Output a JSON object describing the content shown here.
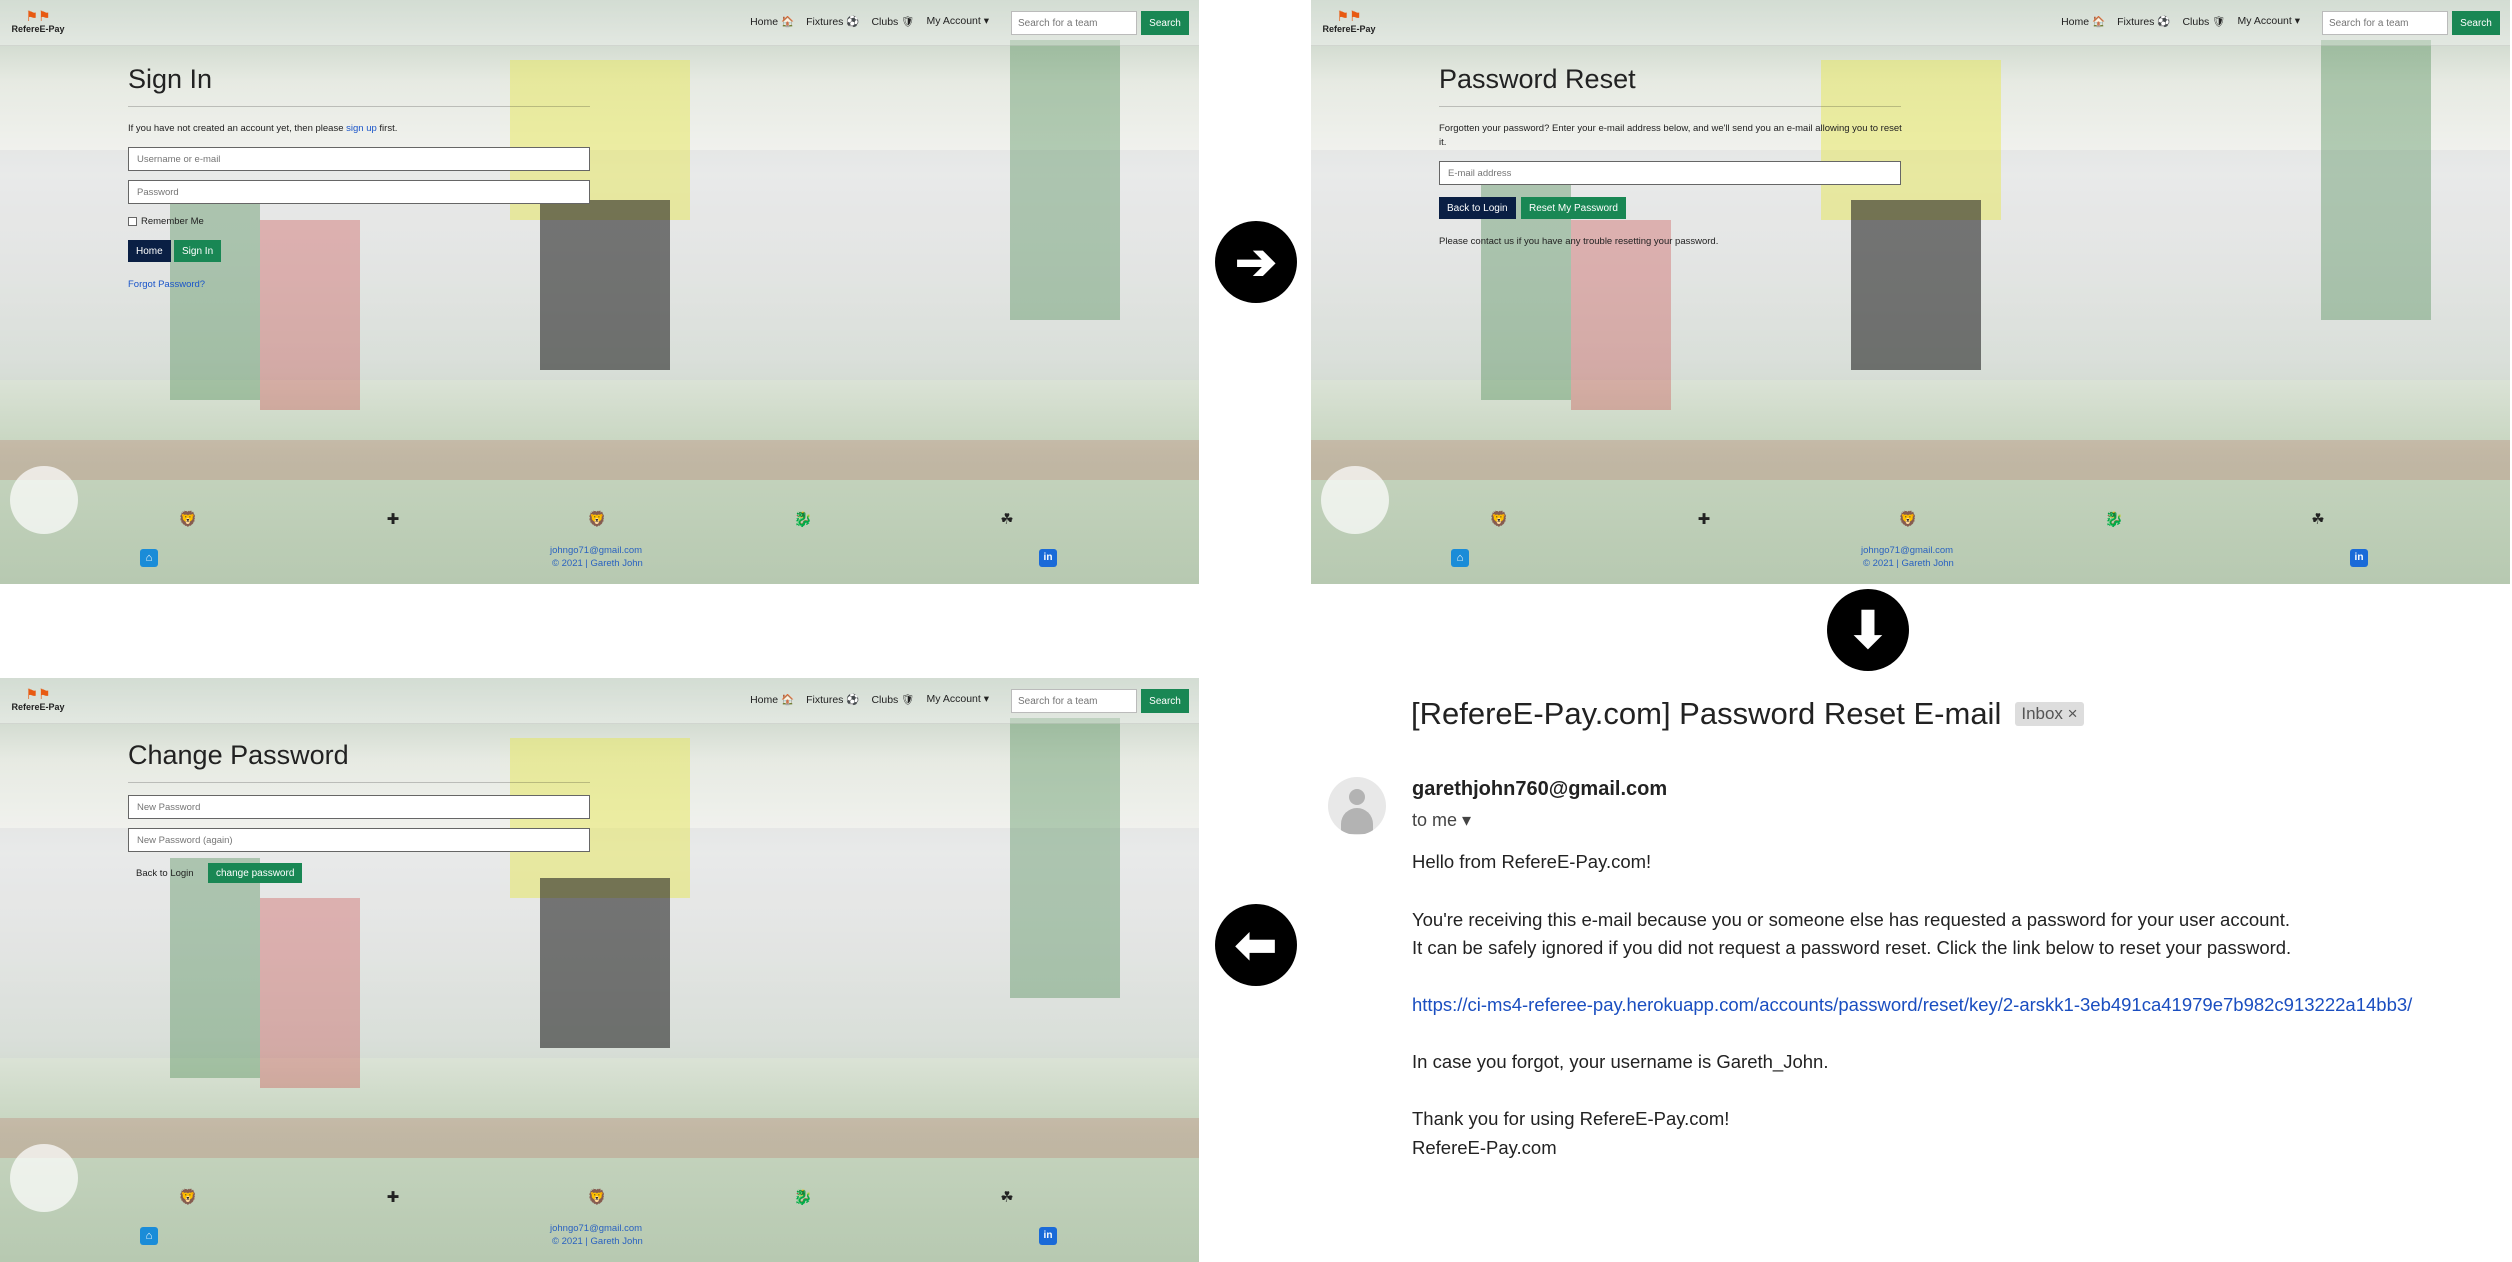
{
  "nav": {
    "logo_flags": "⚑⚑",
    "logo_text": "RefereE-Pay",
    "home": "Home 🏠",
    "fixtures": "Fixtures ⚽",
    "clubs": "Clubs 🛡",
    "account": "My Account ▾",
    "search_placeholder": "Search for a team",
    "search_button": "Search"
  },
  "signin": {
    "title": "Sign In",
    "intro_pre": "If you have not created an account yet, then please ",
    "signup_link": "sign up",
    "intro_post": " first.",
    "username_placeholder": "Username or e-mail",
    "password_placeholder": "Password",
    "remember": "Remember Me",
    "home_button": "Home",
    "signin_button": "Sign In",
    "forgot_link": "Forgot Password?"
  },
  "reset": {
    "title": "Password Reset",
    "intro": "Forgotten your password? Enter your e-mail address below, and we'll send you an e-mail allowing you to reset it.",
    "email_placeholder": "E-mail address",
    "back_button": "Back to Login",
    "reset_button": "Reset My Password",
    "contact_note": "Please contact us if you have any trouble resetting your password."
  },
  "change": {
    "title": "Change Password",
    "new_placeholder": "New Password",
    "again_placeholder": "New Password (again)",
    "back_link": "Back to Login",
    "change_button": "change password"
  },
  "footer": {
    "email": "johngo71@gmail.com",
    "copyright": "© 2021 | Gareth John",
    "github_icon": "⌂",
    "linkedin_icon": "in"
  },
  "badges": [
    "🦁",
    "✚",
    "🦁",
    "🐉",
    "☘"
  ],
  "arrows": {
    "right": "➔",
    "down": "⬇",
    "left": "⬅"
  },
  "email": {
    "subject": "[RefereE-Pay.com] Password Reset E-mail",
    "inbox_badge": "Inbox ×",
    "sender": "garethjohn760@gmail.com",
    "to": "to me ▾",
    "greeting": "Hello from RefereE-Pay.com!",
    "line1": "You're receiving this e-mail because you or someone else has requested a password for your user account.",
    "line2": "It can be safely ignored if you did not request a password reset. Click the link below to reset your password.",
    "link": "https://ci-ms4-referee-pay.herokuapp.com/accounts/password/reset/key/2-arskk1-3eb491ca41979e7b982c913222a14bb3/",
    "username_note": "In case you forgot, your username is Gareth_John.",
    "thanks": "Thank you for using RefereE-Pay.com!",
    "signoff": "RefereE-Pay.com"
  }
}
